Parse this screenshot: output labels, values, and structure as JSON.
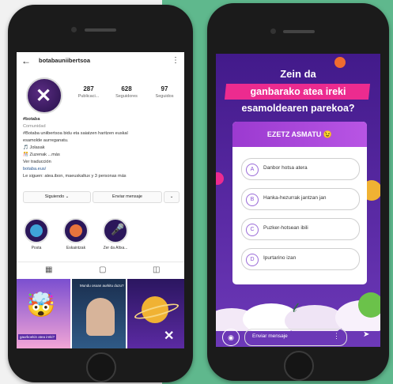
{
  "instagram": {
    "username": "botabauniibertsoa",
    "stats": [
      {
        "value": "287",
        "label": "Publicaci..."
      },
      {
        "value": "628",
        "label": "Seguidores"
      },
      {
        "value": "97",
        "label": "Seguidos"
      }
    ],
    "bio": {
      "name": "#botaba",
      "category": "Comunidad",
      "line1": "#Botaba uniibertsoa bidu eta saiatzen haritzen euskal",
      "line2": "esamolde aurreganatu.",
      "line3": "🎵 Jolasak",
      "line4": "🎊 Zuzenak ...más",
      "line5": "Ver traducción",
      "link": "botaba.eus/",
      "followed": "Le siguen: atea.ibon, maeuskaltux y 3 personas más"
    },
    "buttons": {
      "following": "Siguiendo ⌄",
      "message": "Enviar mensaje",
      "more": "⌄"
    },
    "highlights": [
      {
        "label": "Posta"
      },
      {
        "label": "Eskaintzak"
      },
      {
        "label": "Zer da Altxa..."
      }
    ],
    "grid": [
      {
        "caption": "gaurkoekin atea ireki?"
      },
      {
        "caption": "Mundu osoan aurkitu duzu?"
      },
      {
        "caption": ""
      }
    ]
  },
  "story": {
    "question": {
      "line1": "Zein da",
      "highlight": "ganbarako atea ireki",
      "line3": "esamoldearen parekoa?"
    },
    "quiz": {
      "header": "EZETZ ASMATU 😉",
      "options": [
        {
          "letter": "A",
          "text": "Danbor hotsa atera"
        },
        {
          "letter": "B",
          "text": "Hanka-hezurrak jantzan jan"
        },
        {
          "letter": "C",
          "text": "Puzker-hotsean ibili"
        },
        {
          "letter": "D",
          "text": "Ipurtarino izan"
        }
      ]
    },
    "reply_placeholder": "Enviar mensaje"
  }
}
